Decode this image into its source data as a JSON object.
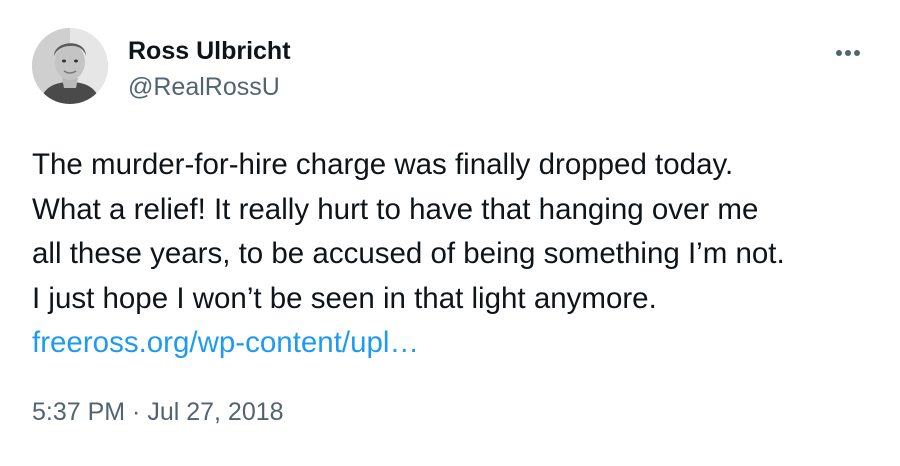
{
  "author": {
    "name": "Ross Ulbricht",
    "handle": "@RealRossU"
  },
  "menu": {
    "icon": "more-horizontal-icon"
  },
  "tweet": {
    "lines": [
      "The murder-for-hire charge was finally dropped today.",
      "What a relief! It really hurt to have that hanging over me",
      "all these years, to be accused of being something I’m not.",
      "I just hope I won’t be seen in that light anymore."
    ],
    "link_text": "freeross.org/wp-content/upl…",
    "timestamp": "5:37 PM · Jul 27, 2018"
  },
  "colors": {
    "text": "#0f1419",
    "secondary": "#536471",
    "link": "#1d9bf0",
    "background": "#ffffff"
  }
}
